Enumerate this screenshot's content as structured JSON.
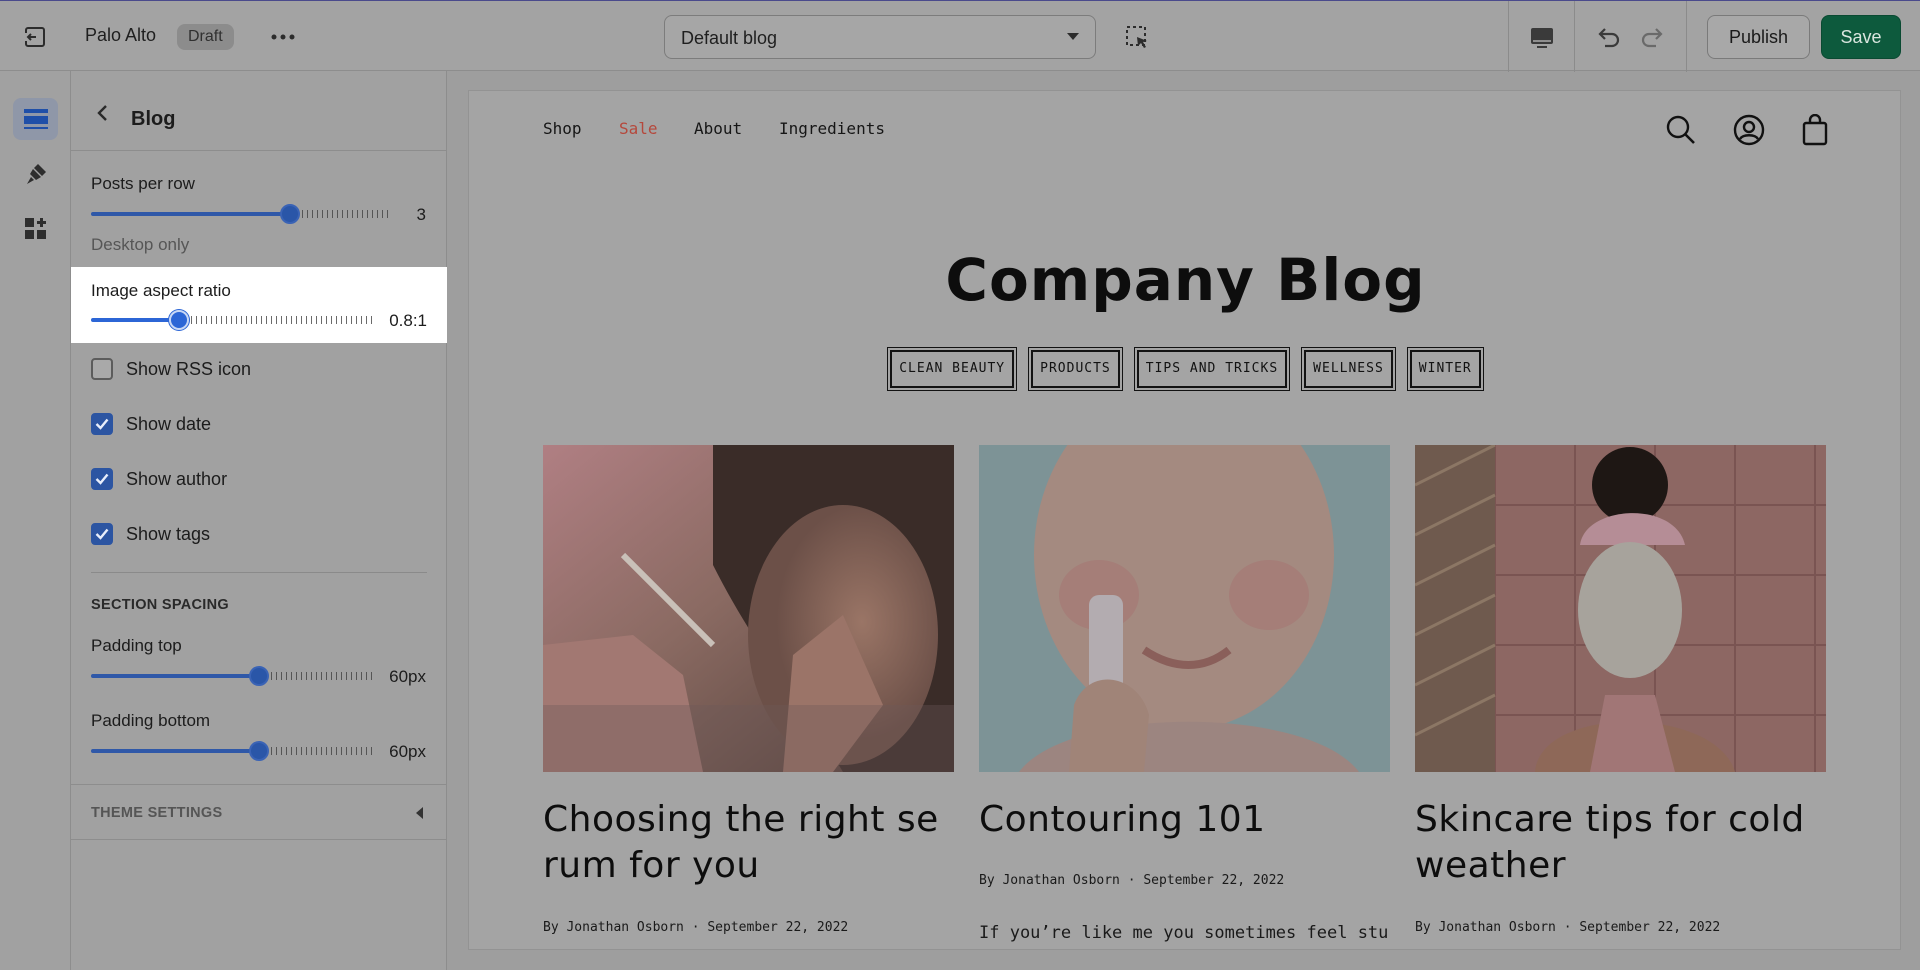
{
  "topbar": {
    "store_name": "Palo Alto",
    "status_badge": "Draft",
    "template_select": "Default blog",
    "publish_label": "Publish",
    "save_label": "Save"
  },
  "panel": {
    "title": "Blog",
    "posts_per_row": {
      "label": "Posts per row",
      "value": "3",
      "fraction": 0.66
    },
    "posts_hint": "Desktop only",
    "aspect_ratio": {
      "label": "Image aspect ratio",
      "value": "0.8:1",
      "fraction": 0.31
    },
    "checkboxes": [
      {
        "label": "Show RSS icon",
        "checked": false
      },
      {
        "label": "Show date",
        "checked": true
      },
      {
        "label": "Show author",
        "checked": true
      },
      {
        "label": "Show tags",
        "checked": true
      }
    ],
    "section_spacing_heading": "SECTION SPACING",
    "padding_top": {
      "label": "Padding top",
      "value": "60px",
      "fraction": 0.59
    },
    "padding_bottom": {
      "label": "Padding bottom",
      "value": "60px",
      "fraction": 0.59
    },
    "theme_settings": "THEME SETTINGS"
  },
  "preview": {
    "nav": [
      "Shop",
      "Sale",
      "About",
      "Ingredients"
    ],
    "sale_color": "#b5483c",
    "title": "Company Blog",
    "tags": [
      "CLEAN BEAUTY",
      "PRODUCTS",
      "TIPS AND TRICKS",
      "WELLNESS",
      "WINTER"
    ],
    "posts": [
      {
        "title": "Choosing the right serum for you",
        "meta": "By Jonathan Osborn · September 22, 2022",
        "excerpt": ""
      },
      {
        "title": "Contouring 101",
        "meta": "By Jonathan Osborn · September 22, 2022",
        "excerpt": "If you’re like me you sometimes feel stuc"
      },
      {
        "title": "Skincare tips for cold weather",
        "meta": "By Jonathan Osborn · September 22, 2022",
        "excerpt": ""
      }
    ]
  },
  "colors": {
    "accent": "#2c66d6",
    "save_button": "#0d5a3d"
  },
  "icons": [
    "exit-icon",
    "more-icon",
    "select-element-icon",
    "desktop-icon",
    "undo-icon",
    "redo-icon",
    "sections-icon",
    "theme-brush-icon",
    "apps-icon",
    "back-chevron-icon",
    "search-icon",
    "account-icon",
    "cart-icon"
  ]
}
